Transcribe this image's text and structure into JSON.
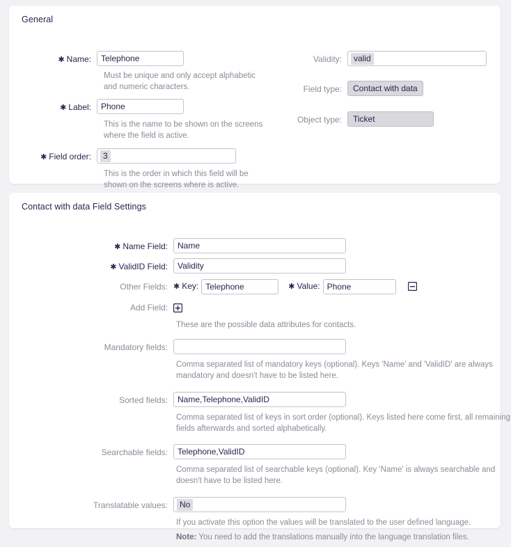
{
  "general": {
    "title": "General",
    "name": {
      "label": "Name:",
      "value": "Telephone",
      "help": "Must be unique and only accept alphabetic and numeric characters."
    },
    "label_field": {
      "label": "Label:",
      "value": "Phone",
      "help": "This is the name to be shown on the screens where the field is active."
    },
    "field_order": {
      "label": "Field order:",
      "value": "3",
      "help": "This is the order in which this field will be shown on the screens where is active."
    },
    "validity": {
      "label": "Validity:",
      "value": "valid"
    },
    "field_type": {
      "label": "Field type:",
      "value": "Contact with data"
    },
    "object_type": {
      "label": "Object type:",
      "value": "Ticket"
    }
  },
  "settings": {
    "title": "Contact with data Field Settings",
    "name_field": {
      "label": "Name Field:",
      "value": "Name"
    },
    "validid_field": {
      "label": "ValidID Field:",
      "value": "Validity"
    },
    "other_fields": {
      "label": "Other Fields:",
      "key_label": "Key:",
      "key_value": "Telephone",
      "value_label": "Value:",
      "value_value": "Phone",
      "remove_icon": "minus-square-icon"
    },
    "add_field": {
      "label": "Add Field:",
      "add_icon": "plus-square-icon",
      "help": "These are the possible data attributes for contacts."
    },
    "mandatory_fields": {
      "label": "Mandatory fields:",
      "value": "",
      "help": "Comma separated list of mandatory keys (optional). Keys 'Name' and 'ValidID' are always mandatory and doesn't have to be listed here."
    },
    "sorted_fields": {
      "label": "Sorted fields:",
      "value": "Name,Telephone,ValidID",
      "help": "Comma separated list of keys in sort order (optional). Keys listed here come first, all remaining fields afterwards and sorted alphabetically."
    },
    "searchable_fields": {
      "label": "Searchable fields:",
      "value": "Telephone,ValidID",
      "help": "Comma separated list of searchable keys (optional). Key 'Name' is always searchable and doesn't have to be listed here."
    },
    "translatable_values": {
      "label": "Translatable values:",
      "value": "No",
      "help": "If you activate this option the values will be translated to the user defined language.",
      "note_label": "Note:",
      "note_text": " You need to add the translations manually into the language translation files."
    }
  }
}
